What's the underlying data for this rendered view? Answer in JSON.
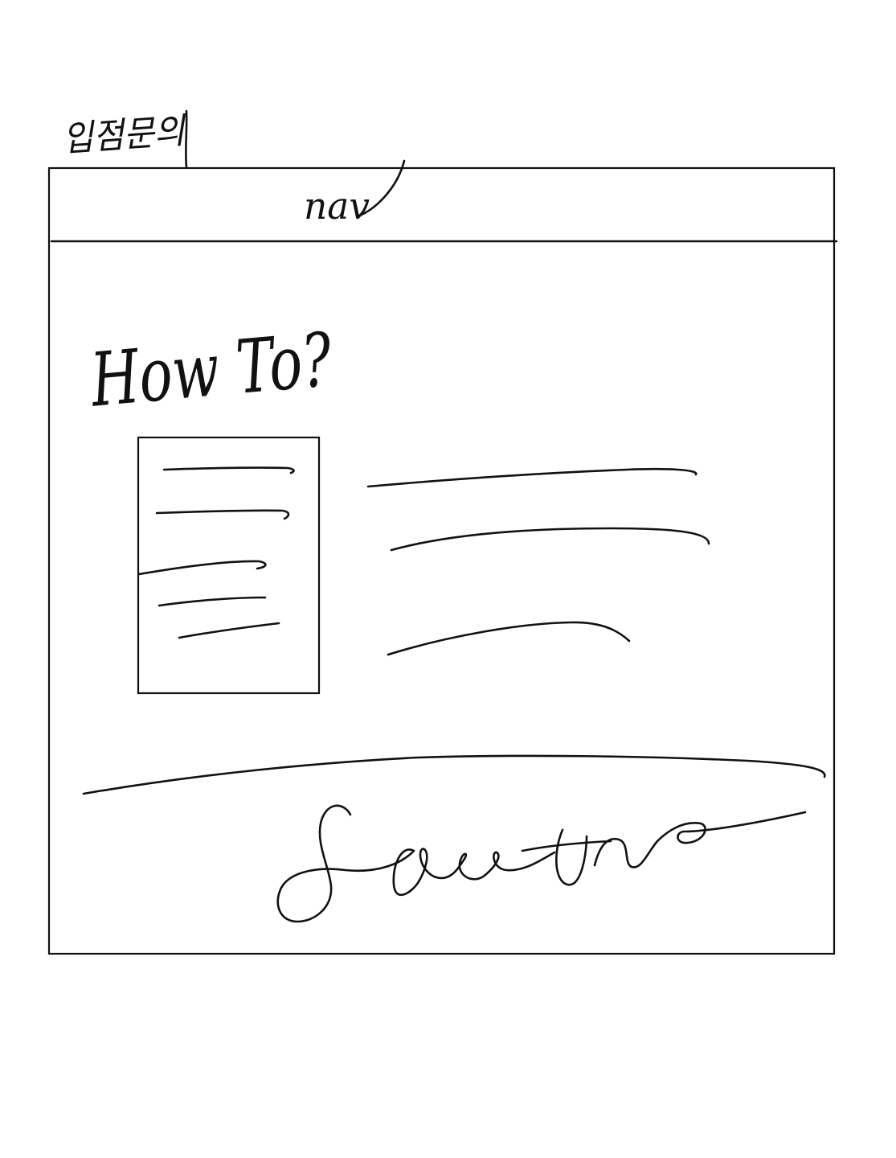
{
  "page_title": "입점문의",
  "nav": {
    "label": "nav"
  },
  "main": {
    "heading": "How To?"
  },
  "footer": {
    "signature": "Signature"
  },
  "colors": {
    "ink": "#111111",
    "background": "#ffffff"
  }
}
